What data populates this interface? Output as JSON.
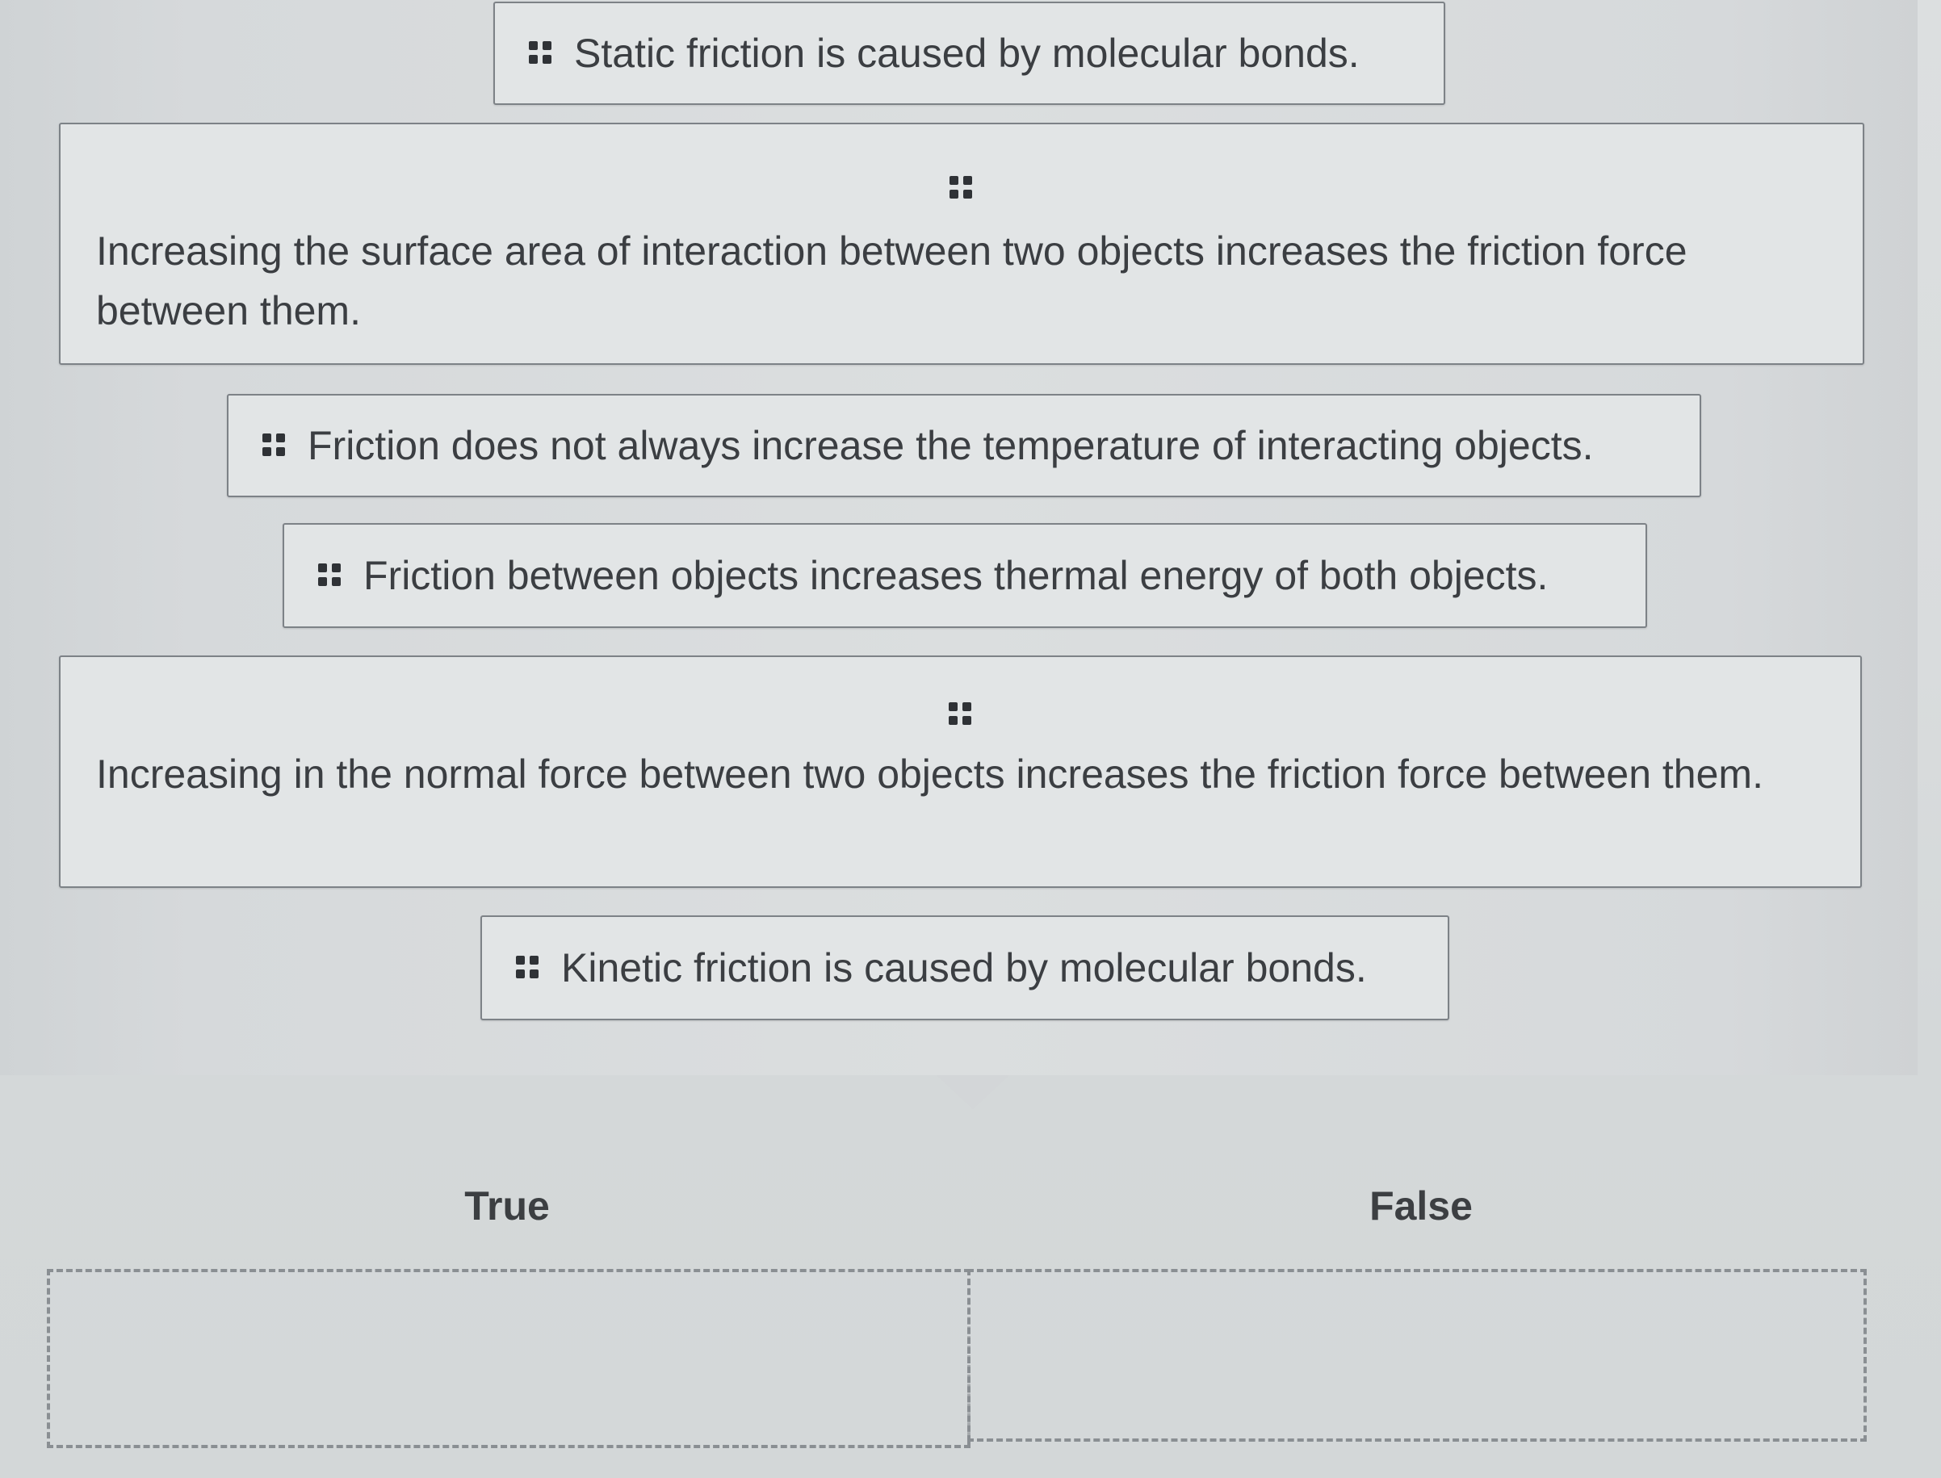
{
  "statements": [
    {
      "id": "static-friction",
      "text": "Static friction is caused by molecular bonds."
    },
    {
      "id": "surface-area",
      "text": "Increasing the surface area of interaction between two objects increases the friction force between them."
    },
    {
      "id": "temperature",
      "text": "Friction does not always increase the temperature of interacting objects."
    },
    {
      "id": "thermal-energy",
      "text": "Friction between objects increases thermal energy of both objects."
    },
    {
      "id": "normal-force",
      "text": "Increasing in the normal force between two objects increases the friction force between them."
    },
    {
      "id": "kinetic-friction",
      "text": "Kinetic friction is caused by molecular bonds."
    }
  ],
  "categories": [
    {
      "label": "True"
    },
    {
      "label": "False"
    }
  ]
}
